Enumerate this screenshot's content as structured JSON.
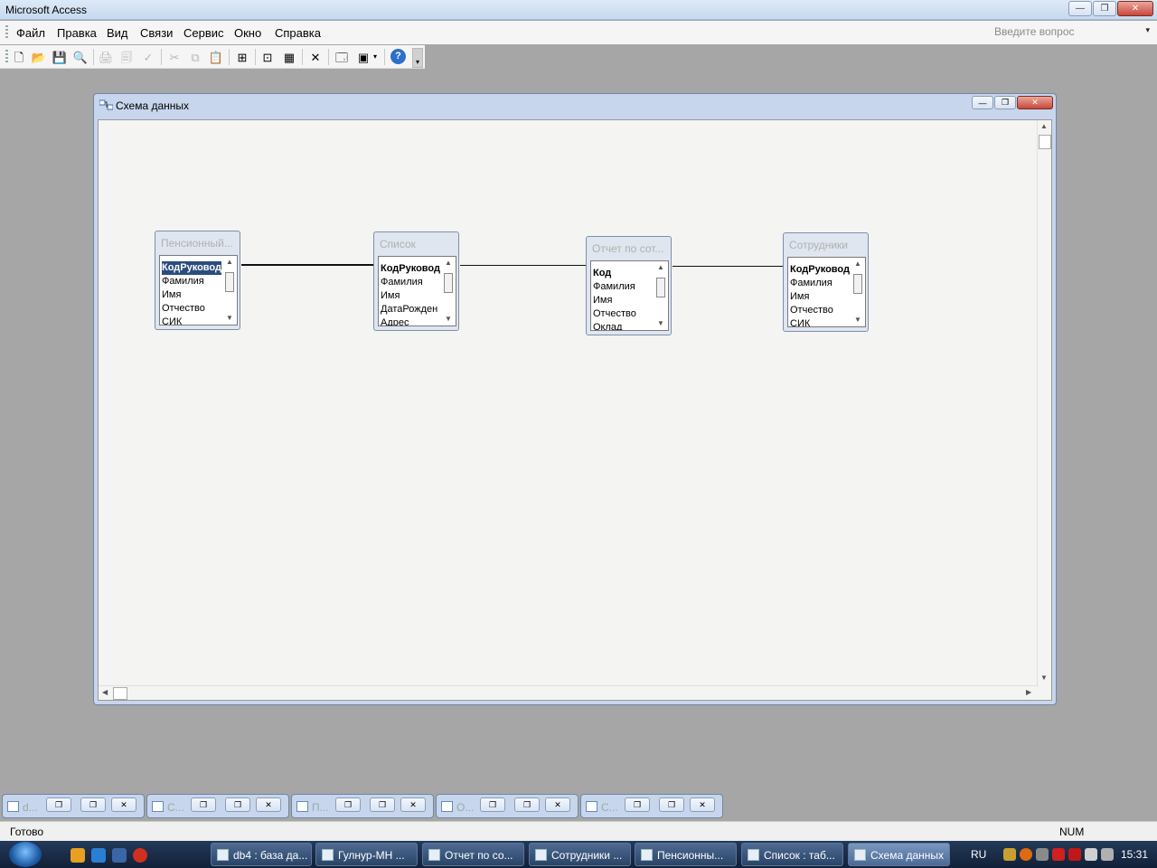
{
  "app": {
    "title": "Microsoft Access",
    "controls": {
      "minimize": "—",
      "restore": "❐",
      "close": "✕"
    }
  },
  "menu": {
    "items": [
      "Файл",
      "Правка",
      "Вид",
      "Связи",
      "Сервис",
      "Окно",
      "Справка"
    ],
    "ask_placeholder": "Введите вопрос",
    "ask_arrow": "▾"
  },
  "toolbar": {
    "icons": [
      "new-icon",
      "open-icon",
      "save-icon",
      "print-preview-icon",
      "print-icon",
      "preview-icon",
      "spell-icon",
      "cut-icon",
      "copy-icon",
      "paste-icon",
      "show-table-icon",
      "direct-relations-icon",
      "all-relations-icon",
      "delete-icon",
      "new-object-icon",
      "database-window-icon",
      "help-icon"
    ],
    "glyphs": {
      "new": "🗋",
      "open": "📂",
      "save": "💾",
      "print_preview": "🔍",
      "print": "🖨",
      "preview": "🗐",
      "spell": "✓",
      "cut": "✂",
      "copy": "⧉",
      "paste": "📋",
      "show_table": "⊞",
      "direct": "⊡",
      "all": "▦",
      "delete": "✕",
      "database": "🗔",
      "new_object": "▣",
      "help": "?",
      "more": "▾"
    }
  },
  "schema_window": {
    "title": "Схема данных",
    "controls": {
      "minimize": "—",
      "restore": "❐",
      "close": "✕"
    },
    "scroll": {
      "up": "▲",
      "down": "▼",
      "left": "◀",
      "right": "▶"
    },
    "tables": [
      {
        "title": "Пенсионный...",
        "fields": [
          "КодРуководи",
          "Фамилия",
          "Имя",
          "Отчество",
          "СИК"
        ],
        "key_index": 0,
        "selected": true
      },
      {
        "title": "Список",
        "fields": [
          "КодРуководи",
          "Фамилия",
          "Имя",
          "ДатаРожден",
          "Адрес"
        ],
        "key_index": 0,
        "selected": false
      },
      {
        "title": "Отчет по сот...",
        "fields": [
          "Код",
          "Фамилия",
          "Имя",
          "Отчество",
          "Оклад"
        ],
        "key_index": 0,
        "selected": false
      },
      {
        "title": "Сотрудники",
        "fields": [
          "КодРуководи",
          "Фамилия",
          "Имя",
          "Отчество",
          "СИК"
        ],
        "key_index": 0,
        "selected": false
      }
    ]
  },
  "minimized_windows": [
    {
      "label": "d..."
    },
    {
      "label": "С..."
    },
    {
      "label": "П..."
    },
    {
      "label": "О..."
    },
    {
      "label": "С..."
    }
  ],
  "status": {
    "text": "Готово",
    "num": "NUM"
  },
  "taskbar": {
    "tasks": [
      {
        "label": "db4 : база да..."
      },
      {
        "label": "Гулнур-МН ..."
      },
      {
        "label": "Отчет по со..."
      },
      {
        "label": "Сотрудники ..."
      },
      {
        "label": "Пенсионны..."
      },
      {
        "label": "Список : таб..."
      },
      {
        "label": "Схема данных"
      }
    ],
    "lang": "RU",
    "clock": "15:31"
  },
  "colors": {
    "titlebar": "#c6d9ef",
    "workspace": "#a6a6a6",
    "selection": "#2b4c7e",
    "taskbar": "#1a2d48"
  }
}
